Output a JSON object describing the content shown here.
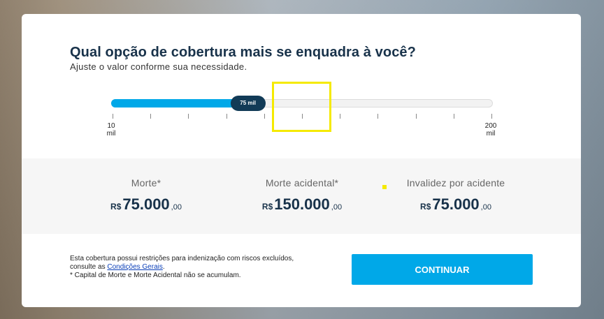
{
  "question": {
    "title": "Qual opção de cobertura mais se enquadra à você?",
    "subtitle": "Ajuste o valor conforme sua necessidade."
  },
  "slider": {
    "min_label_value": "10",
    "min_label_unit": "mil",
    "max_label_value": "200",
    "max_label_unit": "mil",
    "value_label": "75 mil",
    "min": 10,
    "max": 200,
    "value": 75
  },
  "coverages": [
    {
      "label": "Morte*",
      "currency": "R$",
      "integer": "75.000",
      "decimals": ",00"
    },
    {
      "label": "Morte acidental*",
      "currency": "R$",
      "integer": "150.000",
      "decimals": ",00"
    },
    {
      "label": "Invalidez por acidente",
      "currency": "R$",
      "integer": "75.000",
      "decimals": ",00"
    }
  ],
  "notice": {
    "line1": "Esta cobertura possui restrições para indenização com riscos excluídos,",
    "line2_prefix": "consulte as ",
    "link": "Condições Gerais",
    "line2_suffix": ".",
    "line3": "* Capital de Morte e Morte Acidental não se acumulam."
  },
  "button": {
    "continue_label": "CONTINUAR"
  },
  "colors": {
    "accent": "#00a8e8",
    "navy": "#18324a",
    "thumb": "#123b57",
    "highlight": "#f5ea00"
  }
}
